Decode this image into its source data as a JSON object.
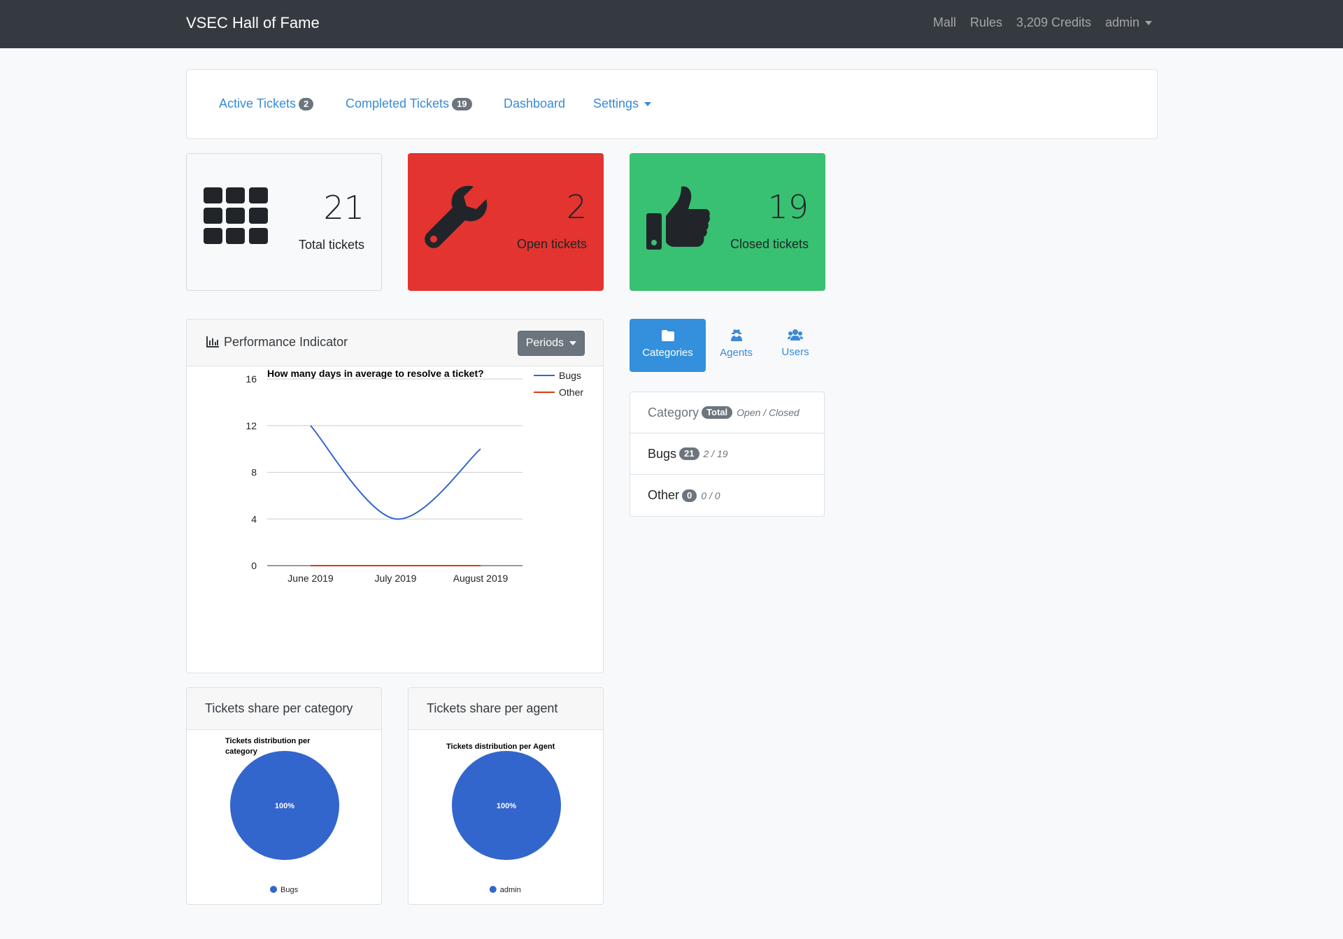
{
  "navbar": {
    "brand": "VSEC Hall of Fame",
    "links": [
      "Mall",
      "Rules",
      "3,209 Credits"
    ],
    "user": "admin"
  },
  "tabs": {
    "active": {
      "label": "Active Tickets",
      "count": "2"
    },
    "completed": {
      "label": "Completed Tickets",
      "count": "19"
    },
    "dashboard": "Dashboard",
    "settings": "Settings"
  },
  "stats": {
    "total": {
      "value": "21",
      "label": "Total tickets",
      "icon": "grid-icon"
    },
    "open": {
      "value": "2",
      "label": "Open tickets",
      "icon": "wrench-icon",
      "color": "#e3342f"
    },
    "closed": {
      "value": "19",
      "label": "Closed tickets",
      "icon": "thumbs-up-icon",
      "color": "#38c172"
    }
  },
  "performance": {
    "title": "Performance Indicator",
    "periods_label": "Periods"
  },
  "chart_data": [
    {
      "type": "line",
      "title": "How many days in average to resolve a ticket?",
      "x": [
        "June 2019",
        "July 2019",
        "August 2019"
      ],
      "series": [
        {
          "name": "Bugs",
          "values": [
            12,
            4,
            10
          ],
          "color": "#3366cc"
        },
        {
          "name": "Other",
          "values": [
            0,
            0,
            0
          ],
          "color": "#dc3912"
        }
      ],
      "yticks": [
        "0",
        "4",
        "8",
        "12",
        "16"
      ],
      "ylim": [
        0,
        16
      ],
      "legend": "right",
      "grid": true
    },
    {
      "type": "pie",
      "title": "Tickets distribution per category",
      "slices": [
        {
          "label": "Bugs",
          "value": 100,
          "text": "100%",
          "color": "#3366cc"
        }
      ]
    },
    {
      "type": "pie",
      "title": "Tickets distribution per Agent",
      "slices": [
        {
          "label": "admin",
          "value": 100,
          "text": "100%",
          "color": "#3366cc"
        }
      ]
    }
  ],
  "shares": {
    "category_title": "Tickets share per category",
    "agent_title": "Tickets share per agent"
  },
  "right_tabs": {
    "categories": "Categories",
    "agents": "Agents",
    "users": "Users"
  },
  "category_list": {
    "header": {
      "label": "Category",
      "badge": "Total",
      "ratio": "Open / Closed"
    },
    "rows": [
      {
        "name": "Bugs",
        "total": "21",
        "ratio": "2 / 19"
      },
      {
        "name": "Other",
        "total": "0",
        "ratio": "0 / 0"
      }
    ]
  }
}
